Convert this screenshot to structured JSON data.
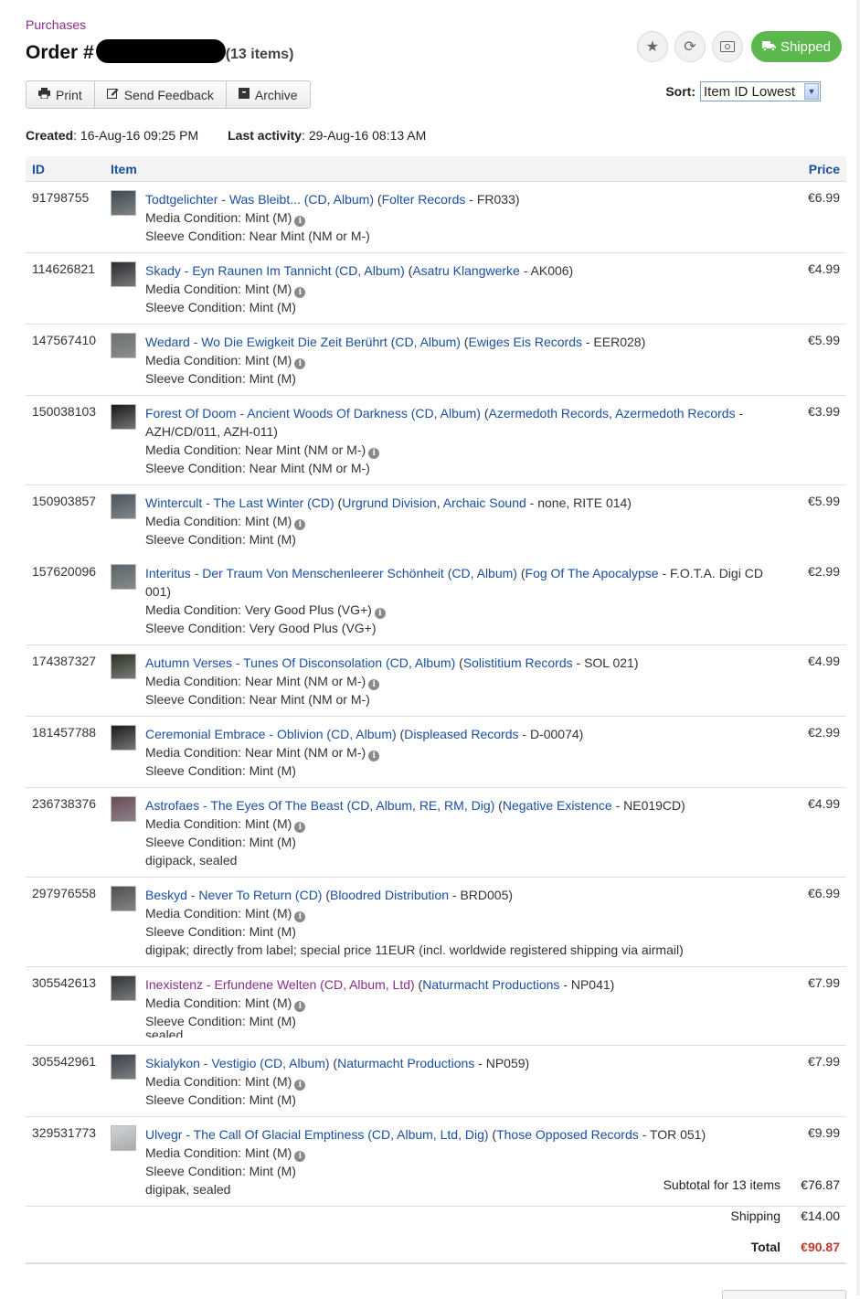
{
  "breadcrumb": "Purchases",
  "order": {
    "prefix": "Order #",
    "count_label": "(13 items)"
  },
  "status": {
    "shipped_label": "Shipped",
    "shipped_color": "#5cb84c"
  },
  "actions": {
    "print": "Print",
    "feedback": "Send Feedback",
    "archive": "Archive"
  },
  "sort": {
    "label": "Sort:",
    "selected": "Item ID Lowest"
  },
  "meta": {
    "created_label": "Created",
    "created_value": ": 16-Aug-16 09:25 PM",
    "activity_label": "Last activity",
    "activity_value": ": 29-Aug-16 08:13 AM"
  },
  "table": {
    "col_id": "ID",
    "col_item": "Item",
    "col_price": "Price"
  },
  "items": [
    {
      "id": "91798755",
      "title": "Todtgelichter - Was Bleibt... (CD, Album)",
      "label": "Folter Records",
      "cat": " - FR033)",
      "media": "Media Condition: Mint (M)",
      "sleeve": "Sleeve Condition: Near Mint (NM or M-)",
      "price": "€6.99"
    },
    {
      "id": "114626821",
      "title": "Skady - Eyn Raunen Im Tannicht (CD, Album)",
      "label": "Asatru Klangwerke",
      "cat": " - AK006)",
      "media": "Media Condition: Mint (M)",
      "sleeve": "Sleeve Condition: Mint (M)",
      "price": "€4.99"
    },
    {
      "id": "147567410",
      "title": "Wedard - Wo Die Ewigkeit Die Zeit Berührt (CD, Album)",
      "label": "Ewiges Eis Records",
      "cat": " - EER028)",
      "media": "Media Condition: Mint (M)",
      "sleeve": "Sleeve Condition: Mint (M)",
      "price": "€5.99"
    },
    {
      "id": "150038103",
      "title": "Forest Of Doom - Ancient Woods Of Darkness (CD, Album)",
      "label": "Azermedoth Records",
      "label2": "Azermedoth Records",
      "cat": " - AZH/CD/011, AZH-011)",
      "media": "Media Condition: Near Mint (NM or M-)",
      "sleeve": "Sleeve Condition: Near Mint (NM or M-)",
      "price": "€3.99"
    },
    {
      "id": "150903857",
      "title": "Wintercult - The Last Winter (CD)",
      "label": "Urgrund Division",
      "label2": "Archaic Sound",
      "cat": " - none, RITE 014)",
      "media": "Media Condition: Mint (M)",
      "sleeve": "Sleeve Condition: Mint (M)",
      "price": "€5.99"
    },
    {
      "id": "157620096",
      "title": "Interitus - Der Traum Von Menschenleerer Schönheit (CD, Album)",
      "label": "Fog Of The Apocalypse",
      "cat": " - F.O.T.A. Digi CD 001)",
      "media": "Media Condition: Very Good Plus (VG+)",
      "sleeve": "Sleeve Condition: Very Good Plus (VG+)",
      "price": "€2.99"
    },
    {
      "id": "174387327",
      "title": "Autumn Verses - Tunes Of Disconsolation (CD, Album)",
      "label": "Solistitium Records",
      "cat": " - SOL 021)",
      "media": "Media Condition: Near Mint (NM or M-)",
      "sleeve": "Sleeve Condition: Near Mint (NM or M-)",
      "price": "€4.99"
    },
    {
      "id": "181457788",
      "title": "Ceremonial Embrace - Oblivion (CD, Album)",
      "label": "Displeased Records",
      "cat": " - D-00074)",
      "media": "Media Condition: Near Mint (NM or M-)",
      "sleeve": "Sleeve Condition: Mint (M)",
      "price": "€2.99"
    },
    {
      "id": "236738376",
      "title": "Astrofaes - The Eyes Of The Beast (CD, Album, RE, RM, Dig)",
      "label": "Negative Existence",
      "cat": " - NE019CD)",
      "media": "Media Condition: Mint (M)",
      "sleeve": "Sleeve Condition: Mint (M)",
      "note": "digipack, sealed",
      "price": "€4.99"
    },
    {
      "id": "297976558",
      "title": "Beskyd - Never To Return (CD)",
      "label": "Bloodred Distribution",
      "cat": " - BRD005)",
      "media": "Media Condition: Mint (M)",
      "sleeve": "Sleeve Condition: Mint (M)",
      "note": "digipak; directly from label; special price 11EUR (incl. worldwide registered shipping via airmail)",
      "price": "€6.99"
    },
    {
      "id": "305542613",
      "title": "Inexistenz - Erfundene Welten (CD, Album, Ltd)",
      "label": "Naturmacht Productions",
      "cat": " - NP041)",
      "media": "Media Condition: Mint (M)",
      "sleeve": "Sleeve Condition: Mint (M)",
      "note": "sealed",
      "price": "€7.99",
      "visited": true
    },
    {
      "id": "305542961",
      "title": "Skialykon - Vestigio (CD, Album)",
      "label": "Naturmacht Productions",
      "cat": " - NP059)",
      "media": "Media Condition: Mint (M)",
      "sleeve": "Sleeve Condition: Mint (M)",
      "price": "€7.99"
    },
    {
      "id": "329531773",
      "title": "Ulvegr - The Call Of Glacial Emptiness (CD, Album, Ltd, Dig)",
      "label": "Those Opposed Records",
      "cat": " - TOR 051)",
      "media": "Media Condition: Mint (M)",
      "sleeve": "Sleeve Condition: Mint (M)",
      "note": "digipak, sealed",
      "price": "€9.99"
    }
  ],
  "totals": {
    "subtotal_label": "Subtotal for 13 items",
    "subtotal": "€76.87",
    "shipping_label": "Shipping",
    "shipping": "€14.00",
    "total_label": "Total",
    "total": "€90.87",
    "total_color": "#c0392b"
  },
  "icons": [
    "star-icon",
    "refresh-icon",
    "money-icon",
    "truck-icon",
    "print-icon",
    "edit-icon",
    "archive-icon",
    "info-icon"
  ]
}
